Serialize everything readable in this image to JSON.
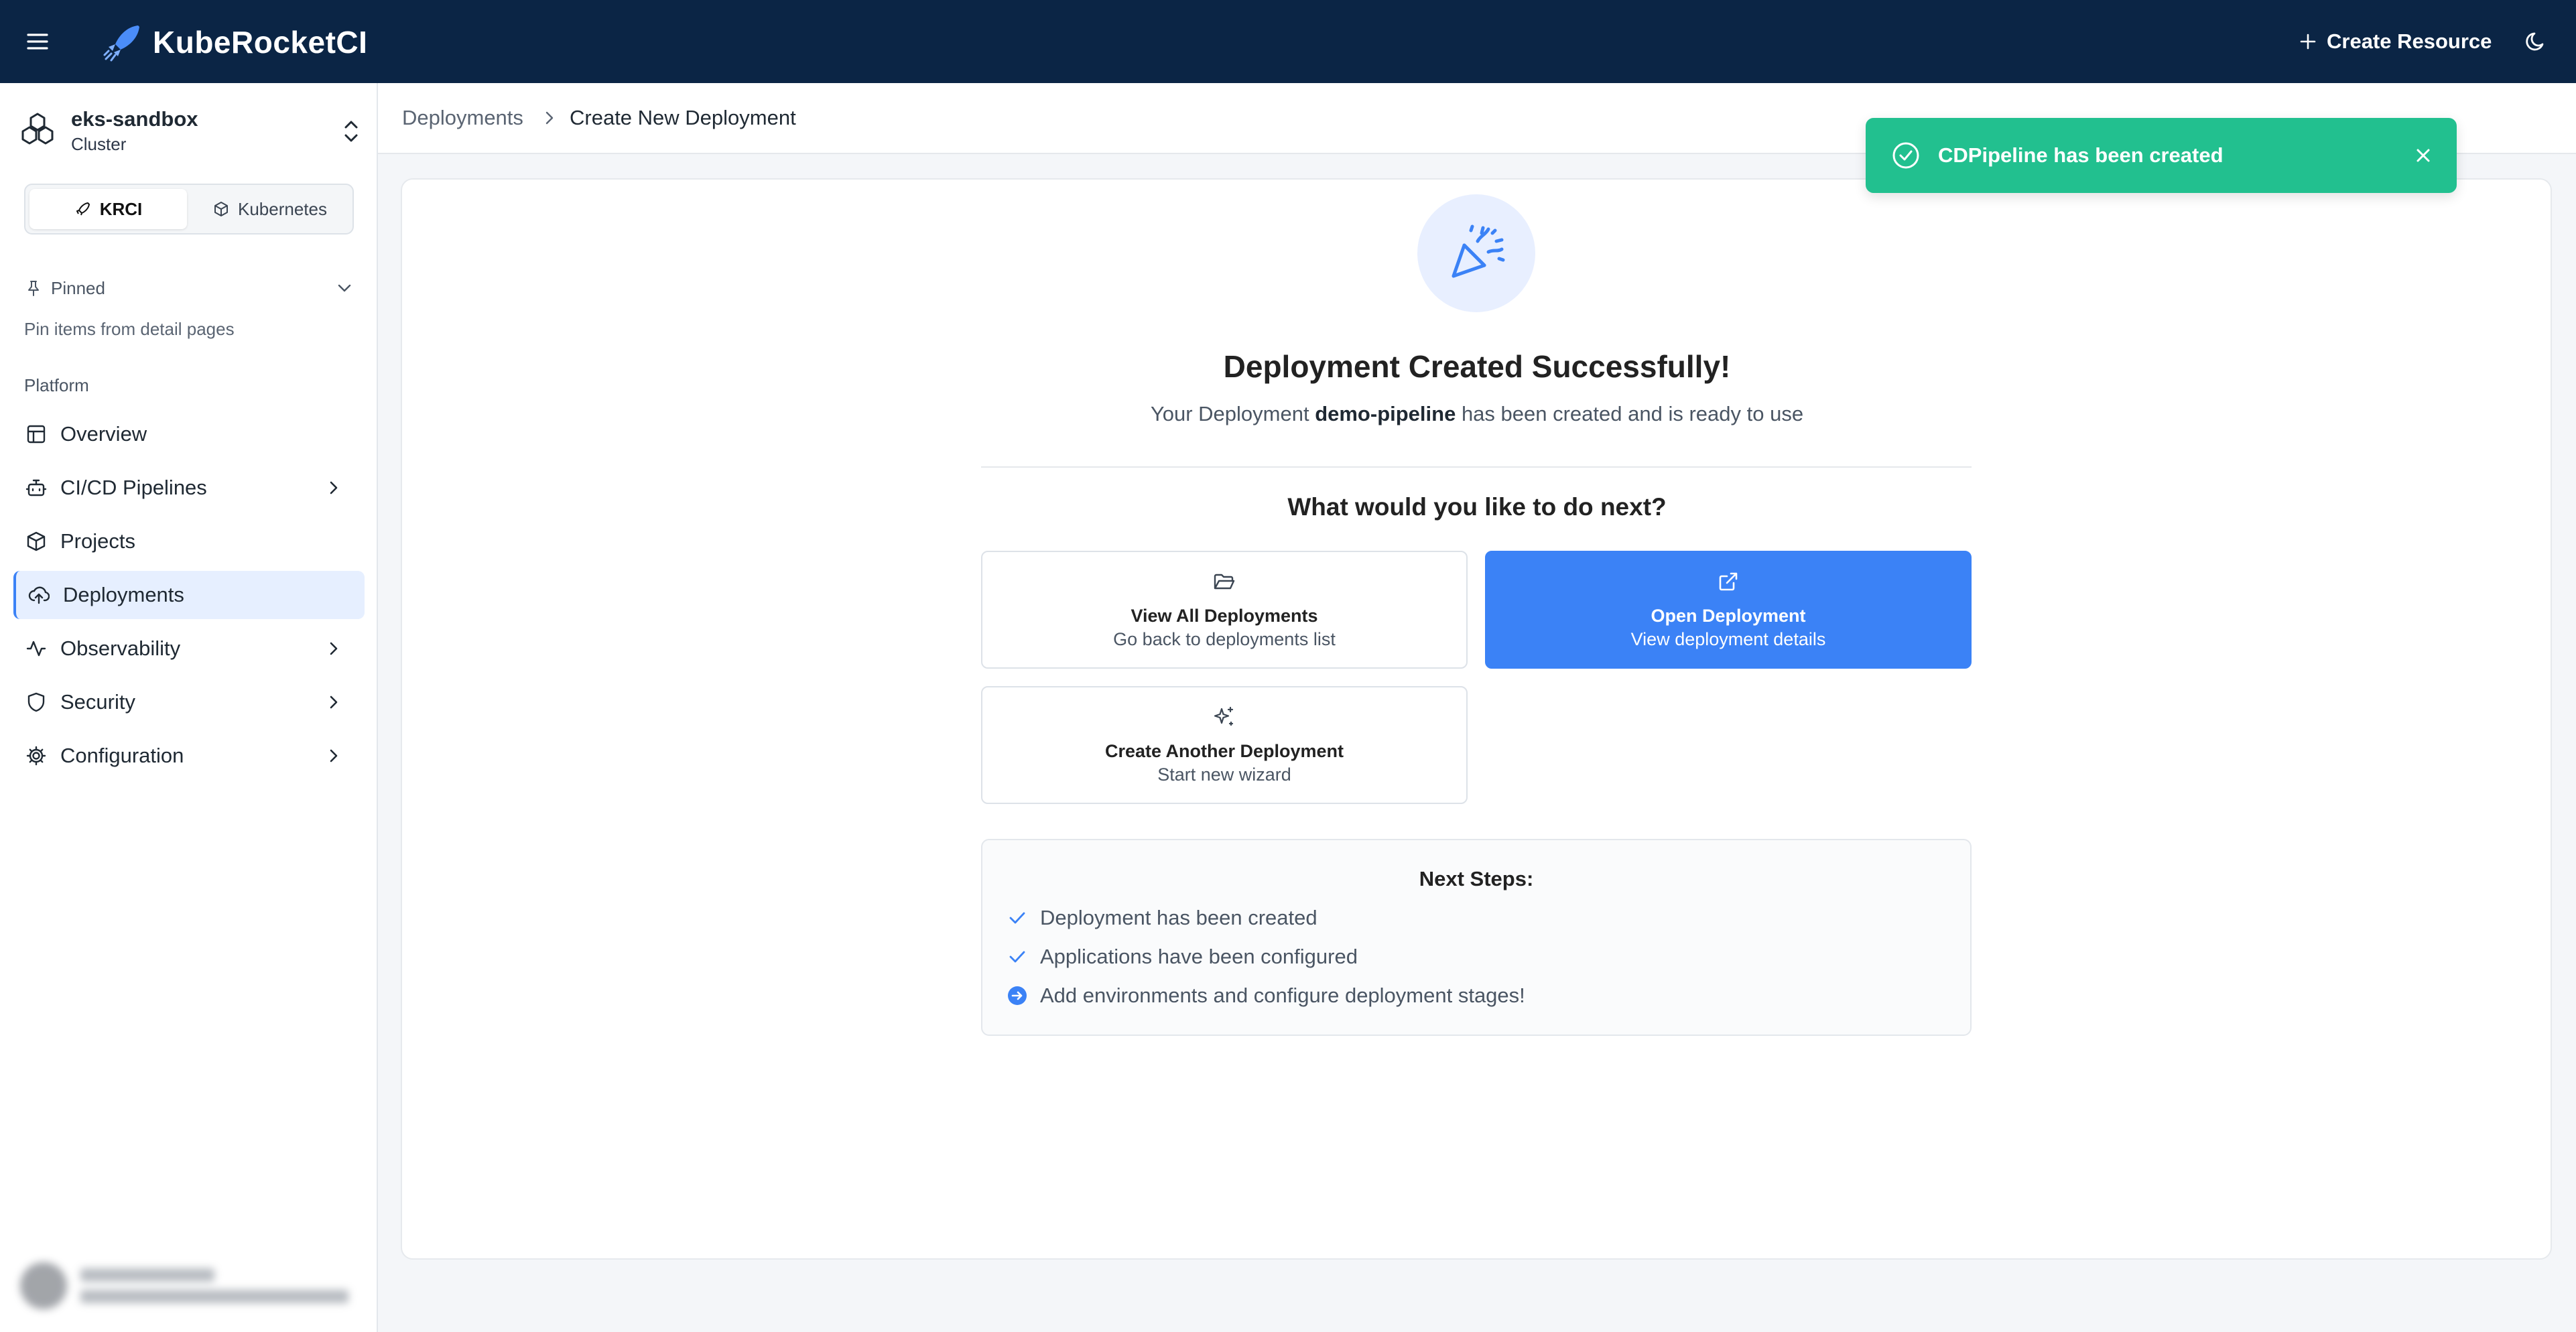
{
  "app": {
    "brand": "KubeRocketCI",
    "create_resource_label": "Create Resource"
  },
  "cluster": {
    "name": "eks-sandbox",
    "type": "Cluster"
  },
  "mode_tabs": [
    {
      "label": "KRCI",
      "active": true
    },
    {
      "label": "Kubernetes",
      "active": false
    }
  ],
  "pinned": {
    "label": "Pinned",
    "hint": "Pin items from detail pages"
  },
  "sidebar": {
    "section_label": "Platform",
    "items": [
      {
        "label": "Overview",
        "icon": "overview-icon",
        "has_children": false,
        "active": false
      },
      {
        "label": "CI/CD Pipelines",
        "icon": "bot-icon",
        "has_children": true,
        "active": false
      },
      {
        "label": "Projects",
        "icon": "box-icon",
        "has_children": false,
        "active": false
      },
      {
        "label": "Deployments",
        "icon": "cloud-upload-icon",
        "has_children": false,
        "active": true
      },
      {
        "label": "Observability",
        "icon": "activity-icon",
        "has_children": true,
        "active": false
      },
      {
        "label": "Security",
        "icon": "shield-icon",
        "has_children": true,
        "active": false
      },
      {
        "label": "Configuration",
        "icon": "gear-icon",
        "has_children": true,
        "active": false
      }
    ]
  },
  "breadcrumb": {
    "parent": "Deployments",
    "current": "Create New Deployment"
  },
  "success": {
    "title": "Deployment Created Successfully!",
    "sub_prefix": "Your Deployment ",
    "name": "demo-pipeline",
    "sub_suffix": " has been created and is ready to use",
    "next_question": "What would you like to do next?"
  },
  "actions": {
    "view_all": {
      "title": "View All Deployments",
      "sub": "Go back to deployments list"
    },
    "open": {
      "title": "Open Deployment",
      "sub": "View deployment details"
    },
    "create_another": {
      "title": "Create Another Deployment",
      "sub": "Start new wizard"
    }
  },
  "next_steps": {
    "title": "Next Steps:",
    "items": [
      {
        "text": "Deployment has been created",
        "status": "done"
      },
      {
        "text": "Applications have been configured",
        "status": "done"
      },
      {
        "text": "Add environments and configure deployment stages!",
        "status": "next"
      }
    ]
  },
  "toast": {
    "message": "CDPipeline has been created"
  },
  "colors": {
    "topbar": "#0b2545",
    "accent": "#3b82f6",
    "toast": "#22c08f"
  }
}
